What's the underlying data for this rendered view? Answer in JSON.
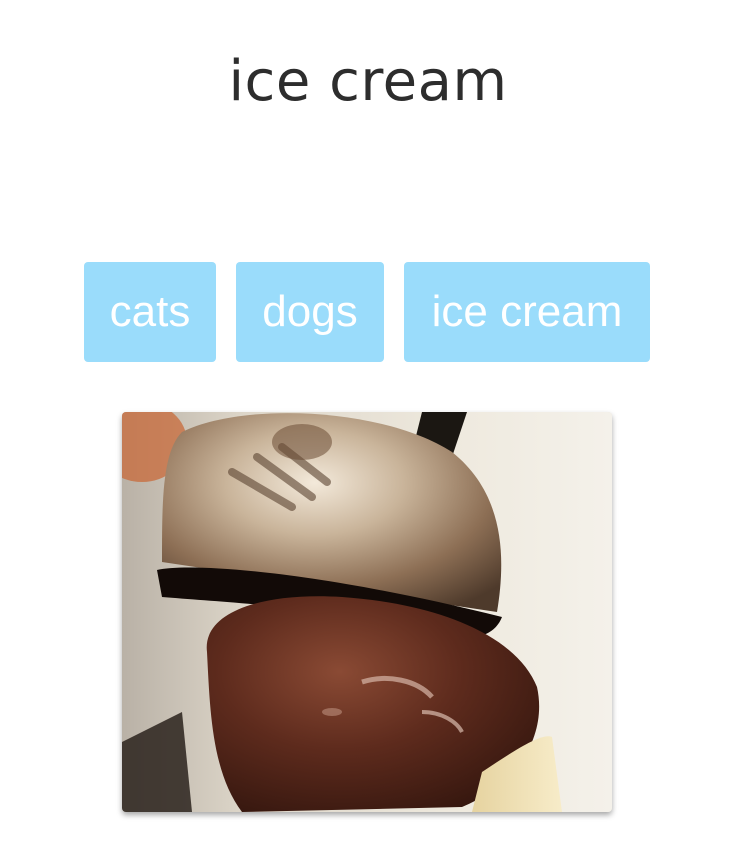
{
  "page": {
    "title": "ice cream"
  },
  "buttons": {
    "cats": "cats",
    "dogs": "dogs",
    "ice_cream": "ice cream"
  },
  "colors": {
    "button_bg": "#9adcfb",
    "button_text": "#ffffff",
    "title_text": "#2d2d2d"
  },
  "image": {
    "subject": "ice-cream-scoop-photo"
  }
}
